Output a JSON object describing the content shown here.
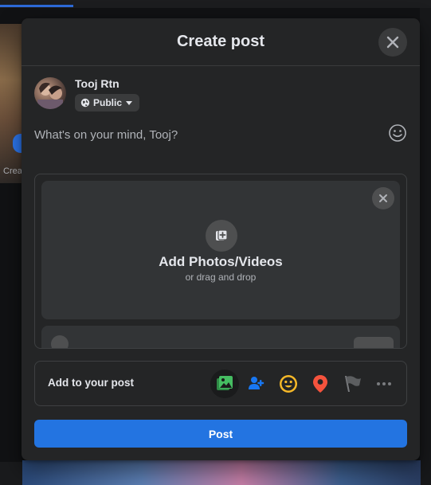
{
  "background": {
    "left_text": "Crea"
  },
  "modal": {
    "title": "Create post",
    "close_label": "✕"
  },
  "user": {
    "name": "Tooj Rtn",
    "privacy": "Public"
  },
  "composer": {
    "placeholder": "What's on your mind, Tooj?"
  },
  "media": {
    "title": "Add Photos/Videos",
    "subtitle": "or drag and drop"
  },
  "add_to_post": {
    "label": "Add to your post",
    "icons": [
      "photo-video-icon",
      "tag-people-icon",
      "feeling-icon",
      "check-in-icon",
      "life-event-flag-icon",
      "more-icon"
    ]
  },
  "actions": {
    "post_label": "Post"
  },
  "colors": {
    "accent": "#2374e1",
    "photo_green": "#45bd62",
    "tag_blue": "#1877f2",
    "feeling_yellow": "#f7b928",
    "checkin_red": "#f5533d"
  }
}
